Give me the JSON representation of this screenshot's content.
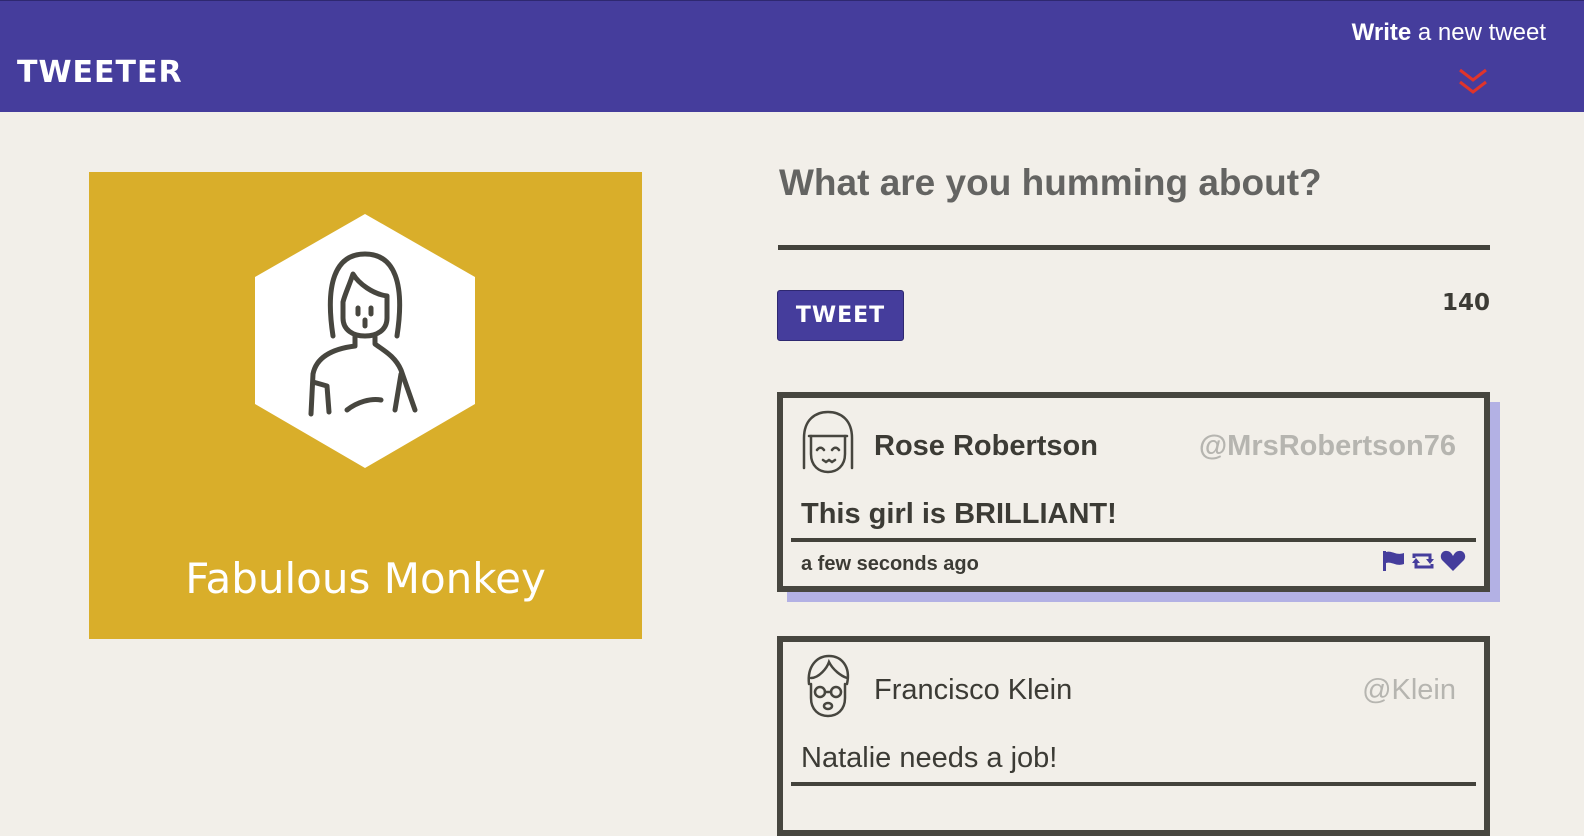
{
  "nav": {
    "brand": "TWEETER",
    "compose_bold": "Write",
    "compose_rest": " a new tweet"
  },
  "profile": {
    "name": "Fabulous Monkey"
  },
  "composer": {
    "prompt": "What are you humming about?",
    "button_label": "TWEET",
    "counter": "140"
  },
  "tweets": [
    {
      "name": "Rose Robertson",
      "handle": "@MrsRobertson76",
      "text": "This girl is BRILLIANT!",
      "time": "a few seconds ago",
      "actions": [
        "flag-icon",
        "retweet-icon",
        "heart-icon"
      ]
    },
    {
      "name": "Francisco Klein",
      "handle": "@Klein",
      "text": "Natalie needs a job!"
    }
  ],
  "colors": {
    "nav": "#453d9c",
    "background": "#f2efe9",
    "profile_card": "#d9ae2a",
    "chevron": "#e0342b",
    "tweet_border": "#47463f",
    "tweet_shadow": "#b3b1e4"
  }
}
